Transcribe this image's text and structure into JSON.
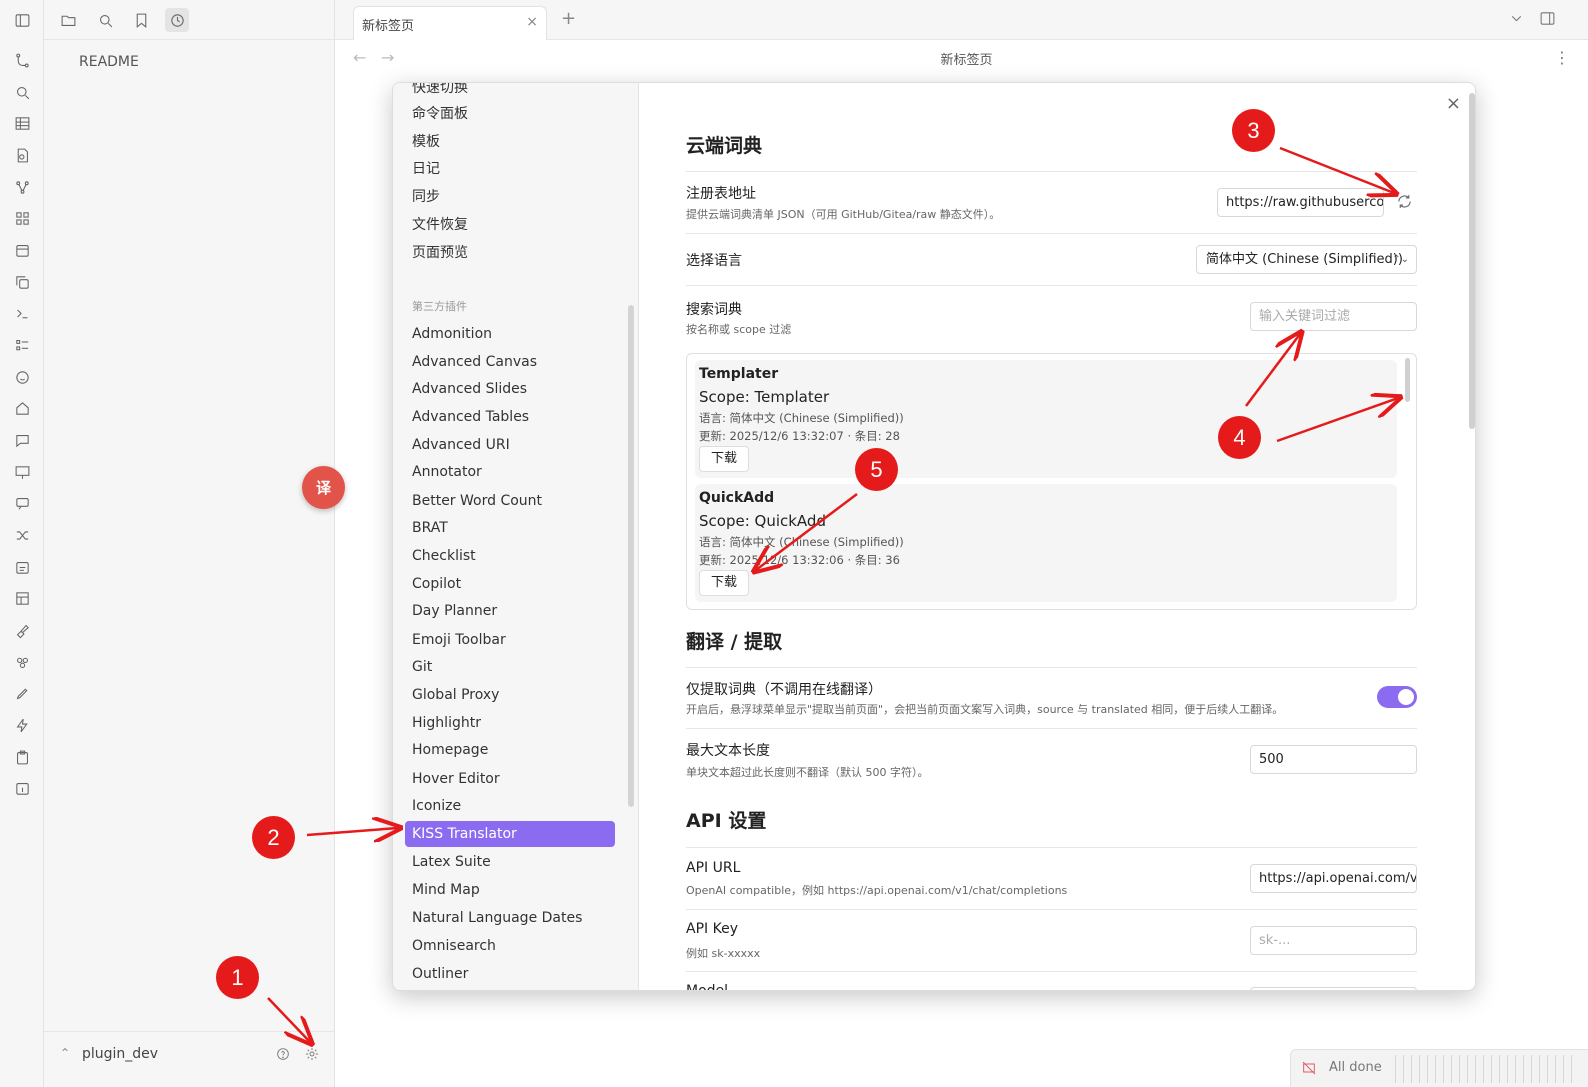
{
  "sidebar": {
    "readme": "README",
    "vault_name": "plugin_dev",
    "fab_label": "译"
  },
  "tabs": {
    "active_title": "新标签页",
    "close": "×",
    "new": "+"
  },
  "navbar": {
    "back": "←",
    "forward": "→",
    "title": "新标签页",
    "more": "⋮"
  },
  "settings_nav": {
    "core_items": [
      "快速切换",
      "命令面板",
      "模板",
      "日记",
      "同步",
      "文件恢复",
      "页面预览"
    ],
    "section_label": "第三方插件",
    "plugin_items": [
      "Admonition",
      "Advanced Canvas",
      "Advanced Slides",
      "Advanced Tables",
      "Advanced URI",
      "Annotator",
      "Better Word Count",
      "BRAT",
      "Checklist",
      "Copilot",
      "Day Planner",
      "Emoji Toolbar",
      "Git",
      "Global Proxy",
      "Highlightr",
      "Homepage",
      "Hover Editor",
      "Iconize",
      "KISS Translator",
      "Latex Suite",
      "Mind Map",
      "Natural Language Dates",
      "Omnisearch",
      "Outliner"
    ],
    "active_item": "KISS Translator"
  },
  "settings": {
    "close": "×",
    "cloud_dict": {
      "heading": "云端词典",
      "registry": {
        "name": "注册表地址",
        "desc": "提供云端词典清单 JSON（可用 GitHub/Gitea/raw 静态文件）。",
        "value": "https://raw.githubuserco"
      },
      "language": {
        "name": "选择语言",
        "value": "简体中文 (Chinese (Simplified))"
      },
      "search": {
        "name": "搜索词典",
        "desc": "按名称或 scope 过滤",
        "placeholder": "输入关键词过滤"
      },
      "cards": [
        {
          "name": "Templater",
          "scope": "Scope: Templater",
          "lang": "语言: 简体中文 (Chinese (Simplified))",
          "updated": "更新: 2025/12/6 13:32:07 · 条目: 28",
          "button": "下载"
        },
        {
          "name": "QuickAdd",
          "scope": "Scope: QuickAdd",
          "lang": "语言: 简体中文 (Chinese (Simplified))",
          "updated": "更新: 2025/12/6 13:32:06 · 条目: 36",
          "button": "下载"
        }
      ]
    },
    "translate": {
      "heading": "翻译 / 提取",
      "extract_only": {
        "name": "仅提取词典（不调用在线翻译）",
        "desc": "开启后，悬浮球菜单显示\"提取当前页面\"，会把当前页面文案写入词典，source 与 translated 相同，便于后续人工翻译。",
        "enabled": true
      },
      "max_len": {
        "name": "最大文本长度",
        "desc": "单块文本超过此长度则不翻译（默认 500 字符）。",
        "value": "500"
      }
    },
    "api": {
      "heading": "API 设置",
      "url": {
        "name": "API URL",
        "desc": "OpenAI compatible，例如 https://api.openai.com/v1/chat/completions",
        "value": "https://api.openai.com/v"
      },
      "key": {
        "name": "API Key",
        "desc": "例如 sk-xxxxx",
        "placeholder": "sk-..."
      },
      "model": {
        "name": "Model"
      }
    }
  },
  "annotations": [
    "1",
    "2",
    "3",
    "4",
    "5"
  ],
  "status": {
    "text": "All done"
  },
  "colors": {
    "accent": "#8b6cf0",
    "annotation": "#e51a1a",
    "fab": "#e2544a"
  }
}
